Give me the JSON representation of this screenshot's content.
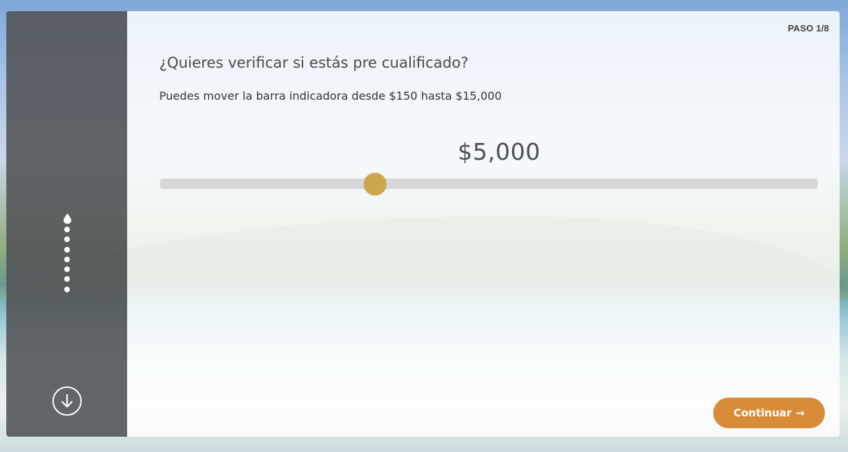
{
  "step": {
    "label": "PASO 1/8",
    "current": 1,
    "total": 8
  },
  "question": {
    "title": "¿Quieres verificar si estás pre cualificado?"
  },
  "hint": {
    "text": "Puedes mover la barra indicadora desde $150 hasta $15,000"
  },
  "slider": {
    "display_value": "$5,000",
    "value": 5000,
    "min": 150,
    "max": 15000,
    "thumb_color": "#cda54a",
    "track_color": "#d7d7d9"
  },
  "actions": {
    "continue_label": "Continuar",
    "continue_arrow": "→",
    "continue_color": "#d88c3a"
  },
  "sidebar": {
    "background": "#54565a",
    "progress_icon": "water-drop-icon",
    "down_icon": "arrow-down-circle-icon"
  }
}
